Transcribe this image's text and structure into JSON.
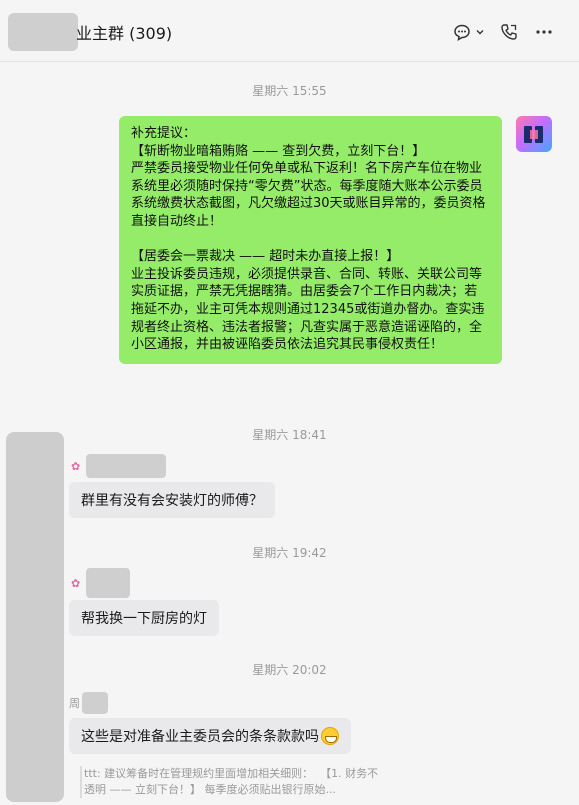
{
  "header": {
    "title": "业主群 (309)",
    "title_visible_suffix": "业主群 (309)",
    "icons": [
      "chat-bubble-icon",
      "chevron-down-icon",
      "phone-icon",
      "more-icon"
    ]
  },
  "messages": [
    {
      "type": "timestamp",
      "text": "星期六 15:55"
    },
    {
      "type": "self",
      "text": "补充提议：\n【斩断物业暗箱贿赂 —— 查到欠费，立刻下台！】\n严禁委员接受物业任何免单或私下返利！名下房产车位在物业系统里必须随时保持“零欠费”状态。每季度随大账本公示委员系统缴费状态截图，凡欠缴超过30天或账目异常的，委员资格直接自动终止！\n\n【居委会一票裁决 —— 超时未办直接上报！】\n业主投诉委员违规，必须提供录音、合同、转账、关联公司等实质证据，严禁无凭据瞎猜。由居委会7个工作日内裁决；若拖延不办，业主可凭本规则通过12345或街道办督办。查实违规者终止资格、违法者报警；凡查实属于恶意造谣诬陷的，全小区通报，并由被诬陷委员依法追究其民事侵权责任！"
    },
    {
      "type": "timestamp",
      "text": "星期六 18:41"
    },
    {
      "type": "other",
      "text": "群里有没有会安装灯的师傅？"
    },
    {
      "type": "timestamp",
      "text": "星期六 19:42"
    },
    {
      "type": "other",
      "text": "帮我换一下厨房的灯"
    },
    {
      "type": "timestamp",
      "text": "星期六 20:02"
    },
    {
      "type": "other",
      "sender_prefix": "周",
      "text": "这些是对准备业主委员会的条条款款吗"
    }
  ],
  "quote": {
    "text": "ttt: 建议筹备时在管理规约里面增加相关细则：  【1. 财务不透明 —— 立刻下台！】 每季度必须贴出银行原始..."
  },
  "colors": {
    "self_bubble": "#95ec69",
    "other_bubble": "#e9e9ec",
    "background": "#f5f5f5"
  }
}
